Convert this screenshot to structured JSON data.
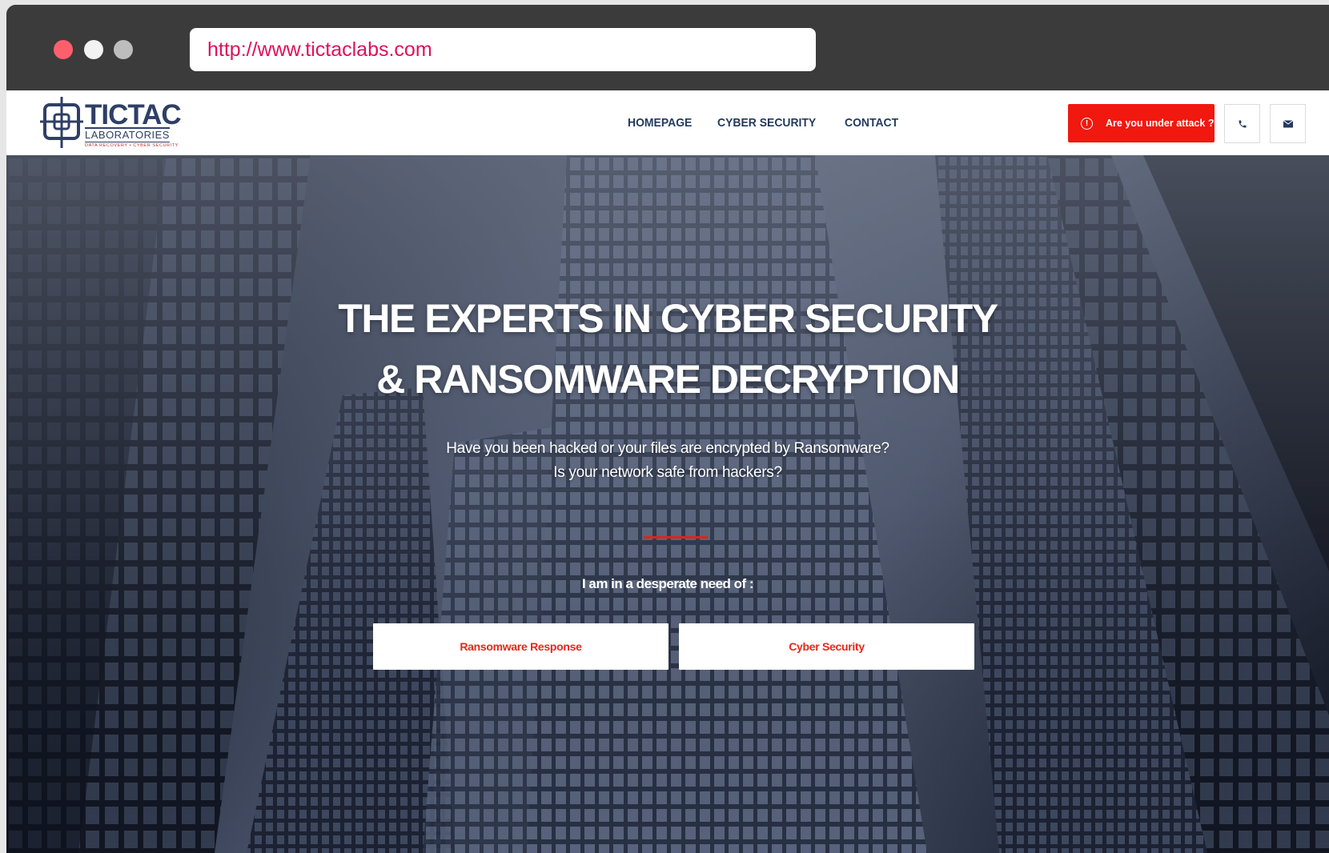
{
  "browser": {
    "url": "http://www.tictaclabs.com"
  },
  "header": {
    "logo": {
      "title": "TICTAC",
      "subtitle": "LABORATORIES",
      "tagline": "DATA RECOVERY • CYBER SECURITY"
    },
    "nav": [
      "HOMEPAGE",
      "CYBER SECURITY",
      "CONTACT"
    ],
    "attack_button": "Are you under attack ?",
    "icons": [
      "alert-icon",
      "phone-icon",
      "mail-icon"
    ],
    "accent_color": "#f1180f"
  },
  "hero": {
    "title_line1": "THE EXPERTS IN CYBER SECURITY",
    "title_line2": "& RANSOMWARE DECRYPTION",
    "sub_line1": "Have you been hacked or your files are encrypted by Ransomware?",
    "sub_line2": "Is your network safe from hackers?",
    "need_label": "I am in a desperate need of :",
    "buttons": [
      "Ransomware Response",
      "Cyber Security"
    ]
  }
}
